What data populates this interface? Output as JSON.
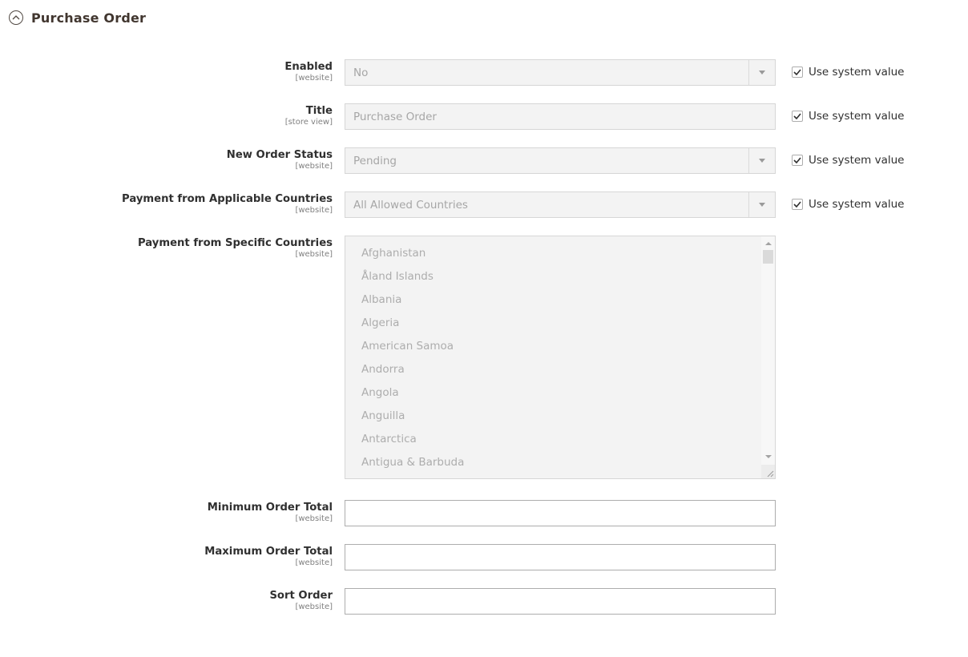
{
  "section": {
    "title": "Purchase Order",
    "icon": "collapse-up-circle-icon"
  },
  "fields": {
    "enabled": {
      "label": "Enabled",
      "scope": "[website]",
      "value": "No",
      "use_system_value_label": "Use system value",
      "use_system_value_checked": true
    },
    "title": {
      "label": "Title",
      "scope": "[store view]",
      "value": "Purchase Order",
      "use_system_value_label": "Use system value",
      "use_system_value_checked": true
    },
    "new_order_status": {
      "label": "New Order Status",
      "scope": "[website]",
      "value": "Pending",
      "use_system_value_label": "Use system value",
      "use_system_value_checked": true
    },
    "applicable_countries": {
      "label": "Payment from Applicable Countries",
      "scope": "[website]",
      "value": "All Allowed Countries",
      "use_system_value_label": "Use system value",
      "use_system_value_checked": true
    },
    "specific_countries": {
      "label": "Payment from Specific Countries",
      "scope": "[website]",
      "options": [
        "Afghanistan",
        "Åland Islands",
        "Albania",
        "Algeria",
        "American Samoa",
        "Andorra",
        "Angola",
        "Anguilla",
        "Antarctica",
        "Antigua & Barbuda"
      ]
    },
    "min_order_total": {
      "label": "Minimum Order Total",
      "scope": "[website]",
      "value": ""
    },
    "max_order_total": {
      "label": "Maximum Order Total",
      "scope": "[website]",
      "value": ""
    },
    "sort_order": {
      "label": "Sort Order",
      "scope": "[website]",
      "value": ""
    }
  }
}
